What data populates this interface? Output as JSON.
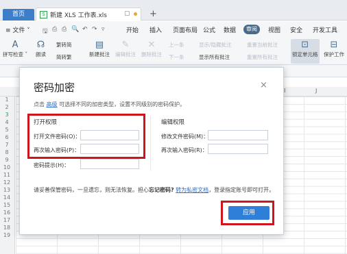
{
  "tabs": {
    "home": "首页",
    "file_tab": "新建 XLS 工作表.xls",
    "add": "+"
  },
  "menu": {
    "file": "≡ 文件 ˅",
    "items": [
      "开始",
      "插入",
      "页面布局",
      "公式",
      "数据",
      "审阅",
      "视图",
      "安全",
      "开发工具"
    ],
    "active": "审阅"
  },
  "ribbon": {
    "spellcheck": "拼写检查 ˅",
    "read": "朗读",
    "trad": "繁转简",
    "simp": "简转繁",
    "new_comment": "新建批注",
    "edit_comment": "编辑批注",
    "delete_comment": "删除批注",
    "prev": "上一条",
    "next": "下一条",
    "show_hide": "显示/隐藏批注",
    "show_all": "显示所有批注",
    "reset_current": "重置当前批注",
    "reset_all": "重置所有批注",
    "lock_cell": "锁定单元格",
    "protect_sheet": "保护工作"
  },
  "columns": [
    "I",
    "J"
  ],
  "rows": [
    "1",
    "2",
    "3",
    "4",
    "5",
    "6",
    "7",
    "8",
    "9",
    "10",
    "11",
    "12",
    "13",
    "14",
    "15",
    "16",
    "17",
    "18",
    "19"
  ],
  "dialog": {
    "title": "密码加密",
    "close": "×",
    "hint_pre": "点击",
    "hint_link": "高级",
    "hint_post": "可选择不同的加密类型，设置不同级别的密码保护。",
    "open_section": "打开权限",
    "open_pwd_label": "打开文件密码(O)：",
    "open_pwd_confirm_label": "再次输入密码(P)：",
    "hint_label": "密码提示(H)：",
    "edit_section": "编辑权限",
    "edit_pwd_label": "修改文件密码(M)：",
    "edit_pwd_confirm_label": "再次输入密码(R)：",
    "note_pre": "请妥善保管密码，一旦遗忘，则无法恢复。担心",
    "note_bold": "忘记密码?",
    "note_link": "转为私密文档",
    "note_post": "，登录指定账号即可打开。",
    "apply": "应用"
  }
}
